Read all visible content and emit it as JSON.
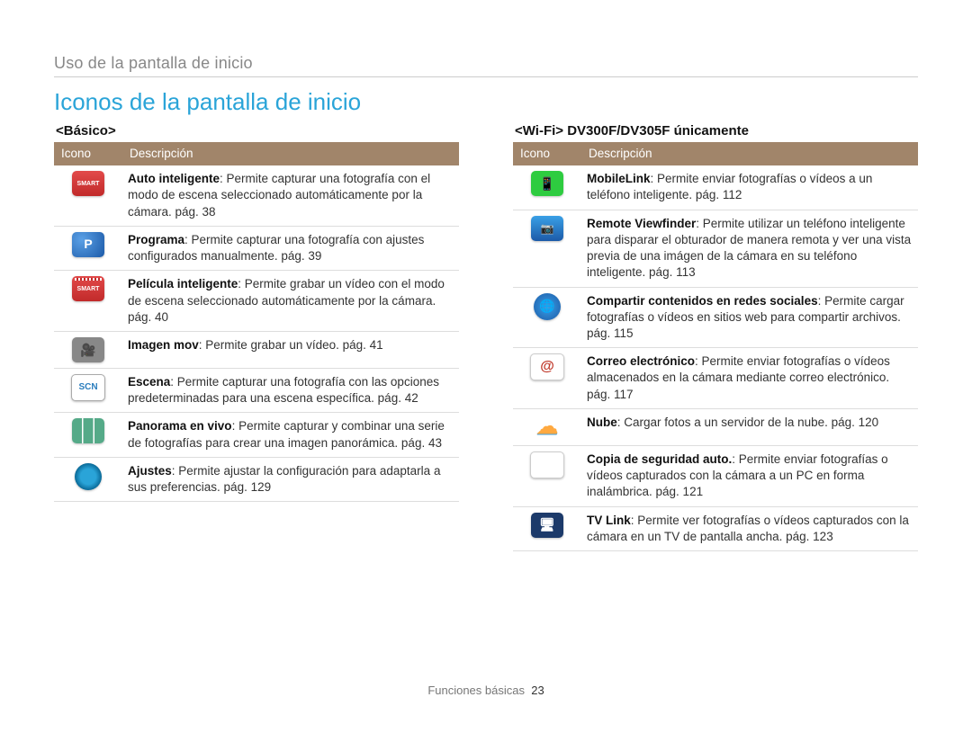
{
  "breadcrumb": "Uso de la pantalla de inicio",
  "title": "Iconos de la pantalla de inicio",
  "header_icon": "Icono",
  "header_desc": "Descripción",
  "footer_section": "Funciones básicas",
  "footer_page": "23",
  "basic": {
    "heading": "<Básico>",
    "rows": [
      {
        "bold": "Auto inteligente",
        "rest": ": Permite capturar una fotografía con el modo de escena seleccionado automáticamente por la cámara. pág. 38"
      },
      {
        "bold": "Programa",
        "rest": ": Permite capturar una fotografía con ajustes configurados manualmente. pág. 39"
      },
      {
        "bold": "Película inteligente",
        "rest": ": Permite grabar un vídeo con el modo de escena seleccionado automáticamente por la cámara. pág. 40"
      },
      {
        "bold": "Imagen mov",
        "rest": ": Permite grabar un vídeo. pág. 41"
      },
      {
        "bold": "Escena",
        "rest": ": Permite capturar una fotografía con las opciones predeterminadas para una escena específica. pág. 42"
      },
      {
        "bold": "Panorama en vivo",
        "rest": ": Permite capturar y combinar una serie de fotografías para crear una imagen panorámica. pág. 43"
      },
      {
        "bold": "Ajustes",
        "rest": ": Permite ajustar la configuración para adaptarla a sus preferencias. pág. 129"
      }
    ]
  },
  "wifi": {
    "heading": "<Wi-Fi> DV300F/DV305F únicamente",
    "rows": [
      {
        "bold": "MobileLink",
        "rest": ": Permite enviar fotografías o vídeos a un teléfono inteligente. pág. 112"
      },
      {
        "bold": "Remote Viewfinder",
        "rest": ": Permite utilizar un teléfono inteligente para disparar el obturador de manera remota y ver una vista previa de una imágen de la cámara en su teléfono inteligente. pág. 113"
      },
      {
        "bold": "Compartir contenidos en redes sociales",
        "rest": ": Permite cargar fotografías o vídeos en sitios web para compartir archivos. pág. 115"
      },
      {
        "bold": "Correo electrónico",
        "rest": ": Permite enviar fotografías o vídeos almacenados en la cámara mediante correo electrónico. pág. 117"
      },
      {
        "bold": "Nube",
        "rest": ": Cargar fotos a un servidor de la nube. pág. 120"
      },
      {
        "bold": "Copia de seguridad auto.",
        "rest": ": Permite enviar fotografías o vídeos capturados con la cámara a un PC en forma inalámbrica. pág. 121"
      },
      {
        "bold": "TV Link",
        "rest": ": Permite ver fotografías o vídeos capturados con la cámara en un TV de pantalla ancha. pág. 123"
      }
    ]
  }
}
